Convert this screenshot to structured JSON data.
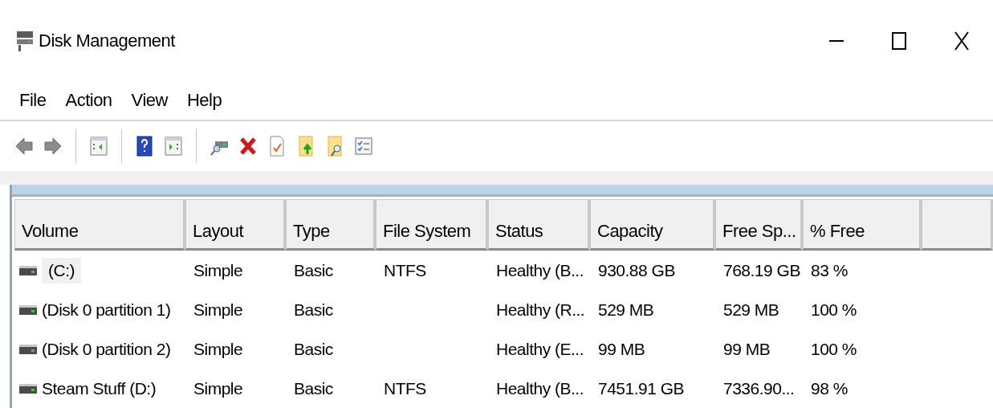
{
  "window": {
    "title": "Disk Management"
  },
  "menu": [
    "File",
    "Action",
    "View",
    "Help"
  ],
  "table": {
    "columns": [
      "Volume",
      "Layout",
      "Type",
      "File System",
      "Status",
      "Capacity",
      "Free Sp...",
      "% Free"
    ],
    "rows": [
      {
        "selected": true,
        "cells": [
          "(C:)",
          "Simple",
          "Basic",
          "NTFS",
          "Healthy (B...",
          "930.88 GB",
          "768.19 GB",
          "83 %"
        ]
      },
      {
        "selected": false,
        "cells": [
          "(Disk 0 partition 1)",
          "Simple",
          "Basic",
          "",
          "Healthy (R...",
          "529 MB",
          "529 MB",
          "100 %"
        ]
      },
      {
        "selected": false,
        "cells": [
          "(Disk 0 partition 2)",
          "Simple",
          "Basic",
          "",
          "Healthy (E...",
          "99 MB",
          "99 MB",
          "100 %"
        ]
      },
      {
        "selected": false,
        "cells": [
          "Steam Stuff (D:)",
          "Simple",
          "Basic",
          "NTFS",
          "Healthy (B...",
          "7451.91 GB",
          "7336.90...",
          "98 %"
        ]
      }
    ]
  }
}
